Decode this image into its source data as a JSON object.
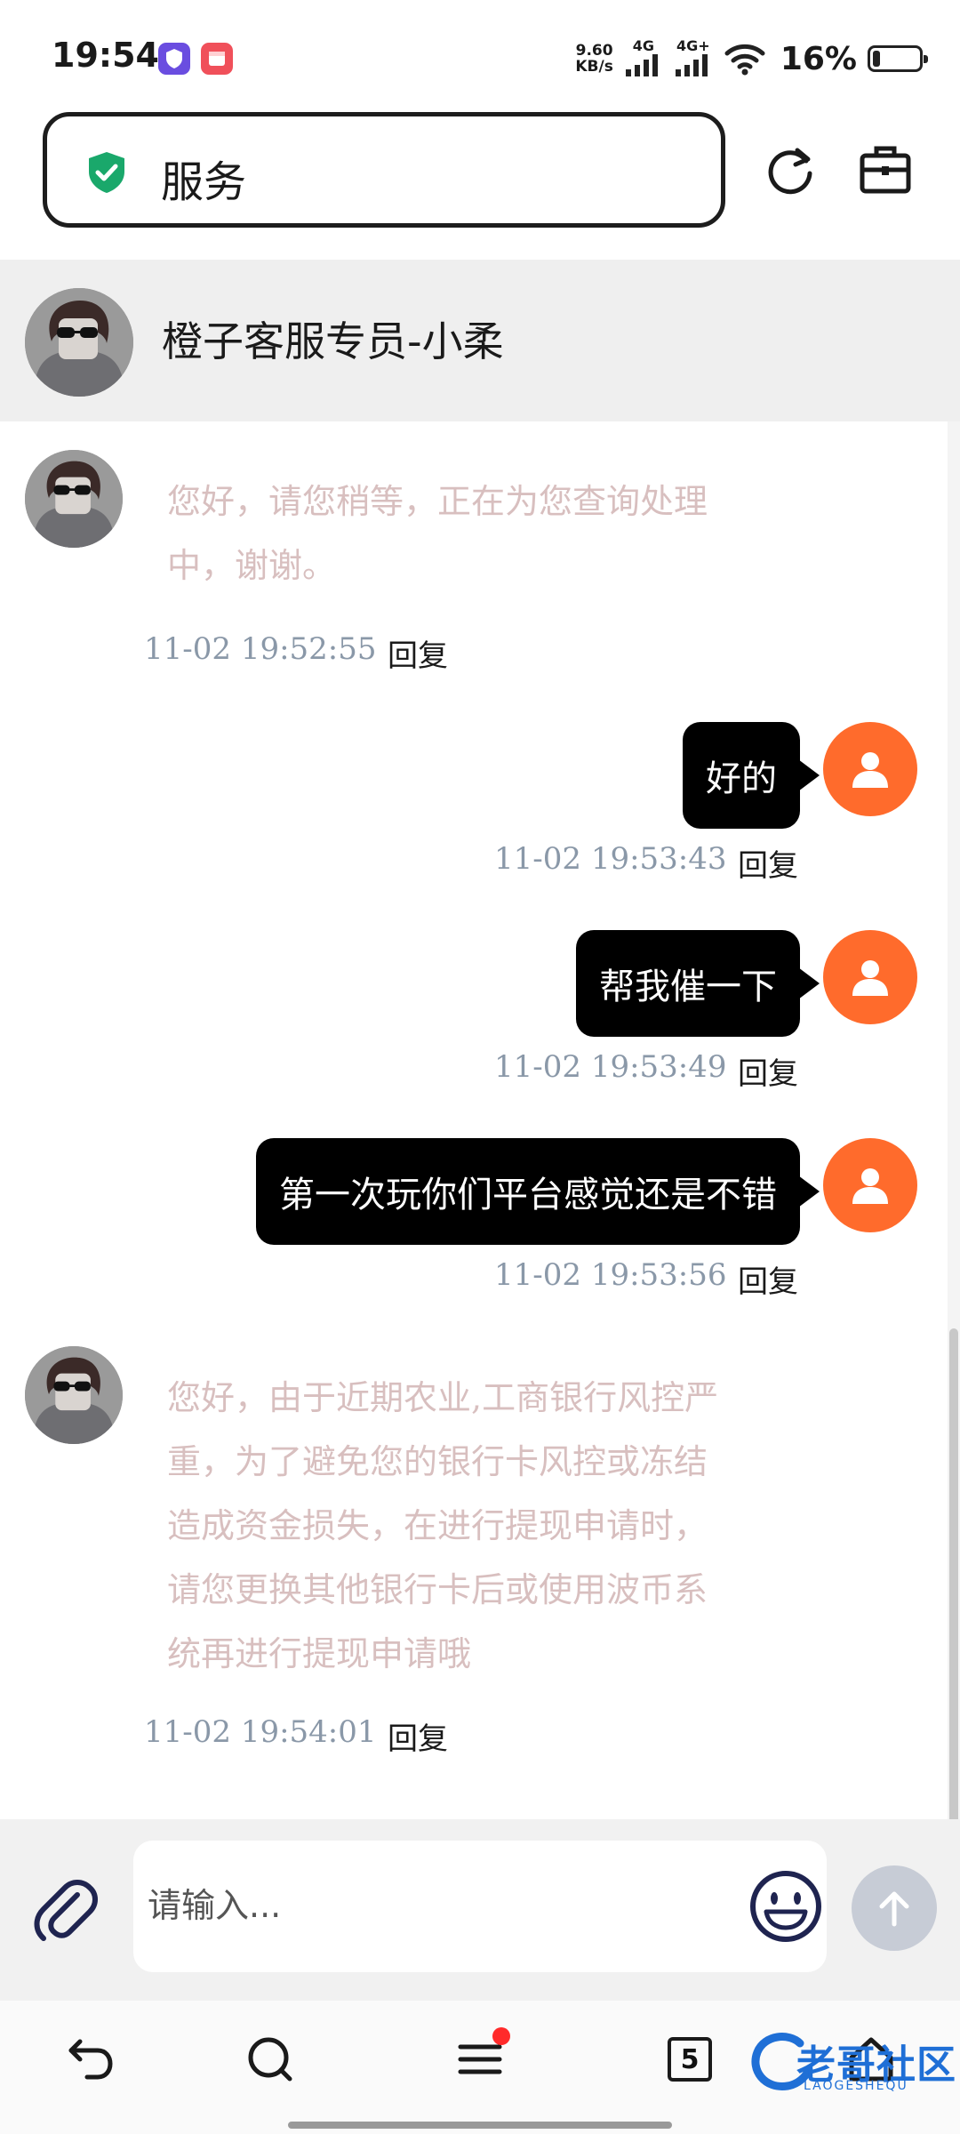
{
  "status_bar": {
    "time": "19:54",
    "net_speed_value": "9.60",
    "net_speed_unit": "KB/s",
    "signal1_label": "4G",
    "signal2_label": "4G+",
    "battery_text": "16%",
    "battery_level": 0.16
  },
  "browser": {
    "address_text": "服务",
    "refresh_icon": "refresh-icon",
    "toolbox_icon": "briefcase-icon"
  },
  "agent": {
    "name": "橙子客服专员-小柔"
  },
  "messages": [
    {
      "direction": "in",
      "text_line1": "您好，请您稍等，正在为您查询处理",
      "text_line2": "中，谢谢。",
      "time": "11-02 19:52:55",
      "reply": "回复"
    },
    {
      "direction": "out",
      "text": "好的",
      "time": "11-02 19:53:43",
      "reply": "回复"
    },
    {
      "direction": "out",
      "text": "帮我催一下",
      "time": "11-02 19:53:49",
      "reply": "回复"
    },
    {
      "direction": "out",
      "text": "第一次玩你们平台感觉还是不错",
      "time": "11-02 19:53:56",
      "reply": "回复"
    },
    {
      "direction": "in",
      "lines": [
        "您好，由于近期农业,工商银行风控严",
        "重，为了避免您的银行卡风控或冻结",
        "造成资金损失，在进行提现申请时，",
        "请您更换其他银行卡后或使用波币系",
        "统再进行提现申请哦"
      ],
      "time": "11-02 19:54:01",
      "reply": "回复"
    }
  ],
  "composer": {
    "placeholder": "请输入...",
    "attach_icon": "paperclip-icon",
    "emoji_icon": "smile-icon",
    "send_icon": "arrow-up-icon"
  },
  "bottom_nav": {
    "tab_count": "5",
    "watermark_text": "老哥社区",
    "watermark_sub": "LAOGESHEQU"
  },
  "colors": {
    "user_avatar": "#ff6b2c",
    "incoming_text": "#d8bfbf",
    "timestamp": "#8a98a8",
    "outgoing_bubble": "#000000",
    "shield_green": "#1aa86b"
  }
}
